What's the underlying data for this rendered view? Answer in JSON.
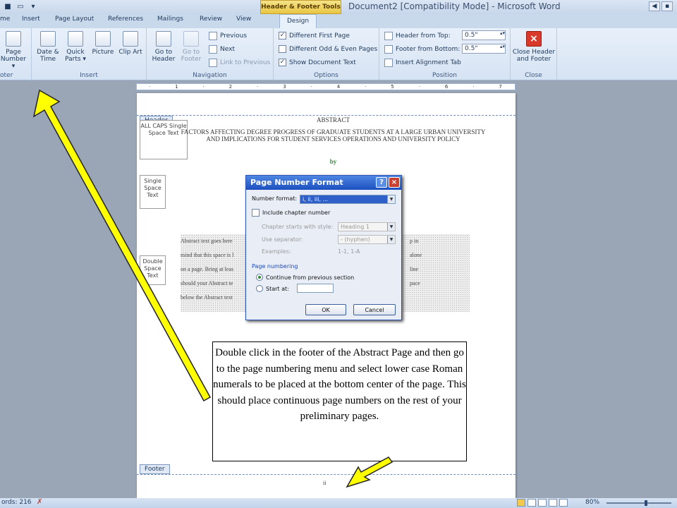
{
  "titlebar": {
    "contextual_tab": "Header & Footer Tools",
    "title": "Document2 [Compatibility Mode] - Microsoft Word"
  },
  "tabs": [
    "me",
    "Insert",
    "Page Layout",
    "References",
    "Mailings",
    "Review",
    "View",
    "Design"
  ],
  "ribbon": {
    "groups": {
      "footer": "oter",
      "insert": "Insert",
      "navigation": "Navigation",
      "options": "Options",
      "position": "Position",
      "close": "Close"
    },
    "page_number": "Page Number ▾",
    "date_time": "Date & Time",
    "quick_parts": "Quick Parts ▾",
    "picture": "Picture",
    "clip_art": "Clip Art",
    "go_to_header": "Go to Header",
    "go_to_footer": "Go to Footer",
    "previous": "Previous",
    "next": "Next",
    "link_to_previous": "Link to Previous",
    "different_first_page": "Different First Page",
    "different_odd_even": "Different Odd & Even Pages",
    "show_document_text": "Show Document Text",
    "header_from_top": "Header from Top:",
    "header_from_top_value": "0.5\"",
    "footer_from_bottom": "Footer from Bottom:",
    "footer_from_bottom_value": "0.5\"",
    "insert_alignment_tab": "Insert Alignment Tab",
    "close_header_footer": "Close Header and Footer"
  },
  "document": {
    "header_tab": "Header",
    "footer_tab": "Footer",
    "abstract_title": "ABSTRACT",
    "subtitle": "FACTORS AFFECTING DEGREE PROGRESS OF GRADUATE STUDENTS AT A LARGE URBAN UNIVERSITY AND IMPLICATIONS FOR STUDENT SERVICES OPERATIONS AND UNIVERSITY POLICY",
    "by": "by",
    "box1": "ALL CAPS Single Space Text",
    "box2": "Single Space Text",
    "box3": "Double Space Text",
    "abstract_lines": [
      "Abstract text goes here",
      "mind that this space is l",
      "on a page.  Bring at leas",
      "should your Abstract te",
      "below the Abstract text"
    ],
    "abstract_right": [
      "p in",
      "alone",
      "line",
      "pace"
    ],
    "page_number": "ii"
  },
  "dialog": {
    "title": "Page Number Format",
    "number_format_label": "Number format:",
    "number_format_value": "i, ii, iii, ...",
    "include_chapter": "Include chapter number",
    "chapter_style_label": "Chapter starts with style:",
    "chapter_style_value": "Heading 1",
    "separator_label": "Use separator:",
    "separator_value": "-   (hyphen)",
    "examples_label": "Examples:",
    "examples_value": "1-1, 1-A",
    "page_numbering": "Page numbering",
    "continue_label": "Continue from previous section",
    "start_at_label": "Start at:",
    "ok": "OK",
    "cancel": "Cancel"
  },
  "callout": "Double click in the footer of the Abstract Page and then go to the page numbering menu and select lower case Roman numerals to be placed at the bottom center of the page. This should place continuous page numbers on the rest of your preliminary pages.",
  "status": {
    "words": "ords: 216",
    "zoom": "80%"
  },
  "colors": {
    "arrow_fill": "#ffff00",
    "dialog_titlebar": "#1c4fbf"
  }
}
